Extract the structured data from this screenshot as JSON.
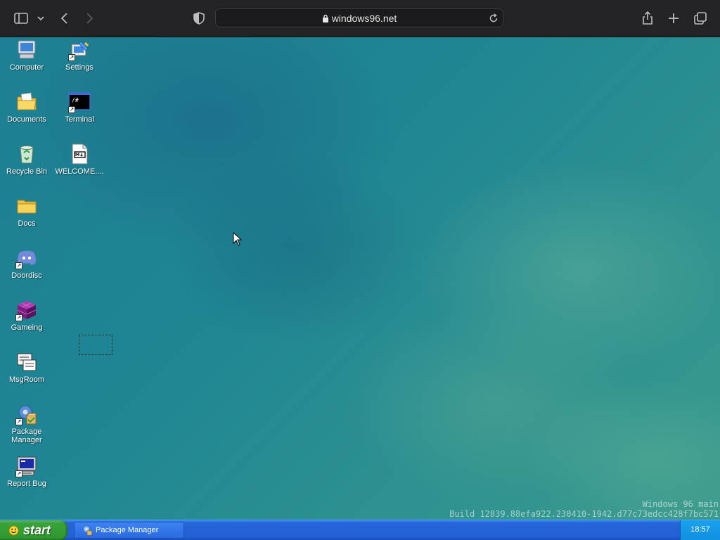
{
  "browser": {
    "url": "windows96.net",
    "icons": {
      "sidebar": "sidebar-toggle-icon",
      "chevron": "chevron-down-icon",
      "back": "back-arrow-icon",
      "forward": "forward-arrow-icon",
      "privacy": "privacy-shield-icon",
      "lock": "lock-icon",
      "reload": "reload-icon",
      "share": "share-icon",
      "new_tab": "plus-icon",
      "tabs": "tabs-overview-icon"
    }
  },
  "desktop": {
    "icons": [
      {
        "label": "Computer",
        "icon": "computer-icon",
        "shortcut": false
      },
      {
        "label": "Settings",
        "icon": "settings-icon",
        "shortcut": true
      },
      {
        "label": "Documents",
        "icon": "documents-icon",
        "shortcut": false
      },
      {
        "label": "Terminal",
        "icon": "terminal-icon",
        "shortcut": true
      },
      {
        "label": "Recycle Bin",
        "icon": "recycle-bin-icon",
        "shortcut": false
      },
      {
        "label": "WELCOME....",
        "icon": "markdown-file-icon",
        "shortcut": false
      },
      {
        "label": "Docs",
        "icon": "folder-icon",
        "shortcut": false
      },
      {
        "label": "Doordisc",
        "icon": "discord-icon",
        "shortcut": true
      },
      {
        "label": "Gameing",
        "icon": "cube-icon",
        "shortcut": true
      },
      {
        "label": "MsgRoom",
        "icon": "msgroom-icon",
        "shortcut": false
      },
      {
        "label": "Package Manager",
        "icon": "package-manager-icon",
        "shortcut": true
      },
      {
        "label": "Report Bug",
        "icon": "report-bug-icon",
        "shortcut": true
      }
    ],
    "terminal_glyph": "/#",
    "build_info": {
      "line1": "Windows 96 main",
      "line2": "Build 12839.88efa922.230410-1942.d77c73edcc428f7bc571"
    }
  },
  "taskbar": {
    "start_label": "start",
    "tasks": [
      {
        "label": "Package Manager",
        "icon": "package-manager-icon"
      }
    ],
    "clock": "18:57"
  },
  "colors": {
    "taskbar_blue": "#245fd6",
    "start_green": "#3aa23a",
    "tray_blue": "#0f8fe0",
    "desktop_teal": "#1f8593"
  }
}
